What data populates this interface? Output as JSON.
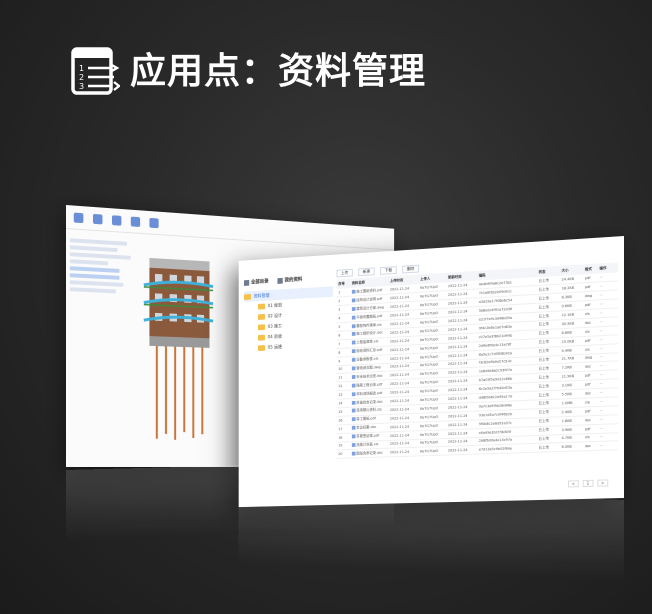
{
  "page": {
    "title": "应用点：资料管理"
  },
  "colors": {
    "background": "#2a2a2a",
    "folder": "#f5c14b",
    "accent": "#2f6bd8"
  },
  "back_window": {
    "icons": [
      "folder-icon",
      "upload-icon",
      "download-icon",
      "share-icon",
      "settings-icon"
    ]
  },
  "front_window": {
    "tabs": [
      {
        "label": "全部目录",
        "icon": "catalog-icon"
      },
      {
        "label": "我的资料",
        "icon": "download-icon"
      }
    ],
    "tree": {
      "root": "资料管理",
      "items": [
        "01 规划",
        "02 设计",
        "03 施工",
        "04 验收",
        "05 运维"
      ]
    },
    "actions": [
      "上传",
      "新建",
      "下载",
      "删除"
    ],
    "columns": [
      "序号",
      "资料名称",
      "上传时间",
      "上传人",
      "更新时间",
      "编码",
      "状态",
      "大小",
      "格式",
      "操作"
    ],
    "rows": [
      {
        "no": "1",
        "name": "施工图纸资料.pdf",
        "date": "2022-11-24",
        "user": "Ke7G7UpO",
        "time": "2022-11-24",
        "code": "4e4b9f9a8c2e73b1",
        "status": "已上传",
        "size": "24.4KB",
        "type": "pdf"
      },
      {
        "no": "2",
        "name": "结构设计说明.pdf",
        "date": "2022-11-24",
        "user": "Ke7G7UpO",
        "time": "2022-11-24",
        "code": "7c1a8f3b2e09d41c",
        "status": "已上传",
        "size": "18.2KB",
        "type": "pdf"
      },
      {
        "no": "3",
        "name": "建筑设计方案.dwg",
        "date": "2022-11-24",
        "user": "Ke7G7UpO",
        "time": "2022-11-24",
        "code": "a3d29e17f08b6c54",
        "status": "已上传",
        "size": "8.3KB",
        "type": "dwg"
      },
      {
        "no": "4",
        "name": "平面布置图纸.pdf",
        "date": "2022-11-24",
        "user": "Ke7G7UpO",
        "time": "2022-11-24",
        "code": "5b8e0c4f91a72d36",
        "status": "已上传",
        "size": "9.6KB",
        "type": "pdf"
      },
      {
        "no": "5",
        "name": "模型构件清单.xls",
        "date": "2022-11-24",
        "user": "Ke7G7UpO",
        "time": "2022-11-24",
        "code": "e21f7a9c3d48b05a",
        "status": "已上传",
        "size": "12.1KB",
        "type": "xls"
      },
      {
        "no": "6",
        "name": "施工组织设计.doc",
        "date": "2022-11-24",
        "user": "Ke7G7UpO",
        "time": "2022-11-24",
        "code": "9f4c2b6e1a07d83e",
        "status": "已上传",
        "size": "30.5KB",
        "type": "doc"
      },
      {
        "no": "7",
        "name": "工程量清单.xls",
        "date": "2022-11-24",
        "user": "Ke7G7UpO",
        "time": "2022-11-24",
        "code": "c07e5a3f8b21d94b",
        "status": "已上传",
        "size": "6.8KB",
        "type": "xls"
      },
      {
        "no": "8",
        "name": "验收资料汇总.pdf",
        "date": "2022-11-24",
        "user": "Ke7G7UpO",
        "time": "2022-11-24",
        "code": "2d9b6f0e4c13a78f",
        "status": "已上传",
        "size": "15.0KB",
        "type": "pdf"
      },
      {
        "no": "9",
        "name": "设备参数表.xls",
        "date": "2022-11-24",
        "user": "Ke7G7UpO",
        "time": "2022-11-24",
        "code": "8a5e1c7d3f06b92a",
        "status": "已上传",
        "size": "4.4KB",
        "type": "xls"
      },
      {
        "no": "10",
        "name": "管线综合图.dwg",
        "date": "2022-11-24",
        "user": "Ke7G7UpO",
        "time": "2022-11-24",
        "code": "f3c82a9b0e57d14c",
        "status": "已上传",
        "size": "21.7KB",
        "type": "dwg"
      },
      {
        "no": "11",
        "name": "安全技术交底.doc",
        "date": "2022-11-24",
        "user": "Ke7G7UpO",
        "time": "2022-11-24",
        "code": "1e6d4b8a2c93f07e",
        "status": "已上传",
        "size": "7.2KB",
        "type": "doc"
      },
      {
        "no": "12",
        "name": "隐蔽工程记录.pdf",
        "date": "2022-11-24",
        "user": "Ke7G7UpO",
        "time": "2022-11-24",
        "code": "b7a03f5e9d12c68b",
        "status": "已上传",
        "size": "11.9KB",
        "type": "pdf"
      },
      {
        "no": "13",
        "name": "材料进场报验.pdf",
        "date": "2022-11-24",
        "user": "Ke7G7UpO",
        "time": "2022-11-24",
        "code": "6c2e9a1f7b40d53a",
        "status": "已上传",
        "size": "3.1KB",
        "type": "pdf"
      },
      {
        "no": "14",
        "name": "质量检查记录.doc",
        "date": "2022-11-24",
        "user": "Ke7G7UpO",
        "time": "2022-11-24",
        "code": "d48f0b6c2a95e17d",
        "status": "已上传",
        "size": "5.5KB",
        "type": "doc"
      },
      {
        "no": "15",
        "name": "现场照片资料.zip",
        "date": "2022-11-24",
        "user": "Ke7G7UpO",
        "time": "2022-11-24",
        "code": "0a7c3e9f5b28d46e",
        "status": "已上传",
        "size": "1.0MB",
        "type": "zip"
      },
      {
        "no": "16",
        "name": "竣工图纸.pdf",
        "date": "2022-11-24",
        "user": "Ke7G7UpO",
        "time": "2022-11-24",
        "code": "93e1d5a7c0f46b2b",
        "status": "已上传",
        "size": "2.4KB",
        "type": "pdf"
      },
      {
        "no": "17",
        "name": "会议纪要.doc",
        "date": "2022-11-24",
        "user": "Ke7G7UpO",
        "time": "2022-11-24",
        "code": "5f0b8c2e6d91a37c",
        "status": "已上传",
        "size": "1.8KB",
        "type": "doc"
      },
      {
        "no": "18",
        "name": "变更签证单.pdf",
        "date": "2022-11-24",
        "user": "Ke7G7UpO",
        "time": "2022-11-24",
        "code": "c6a49e3b1f78d05f",
        "status": "已上传",
        "size": "3.9KB",
        "type": "pdf"
      },
      {
        "no": "19",
        "name": "进度计划表.xls",
        "date": "2022-11-24",
        "user": "Ke7G7UpO",
        "time": "2022-11-24",
        "code": "2b8f6d0a4e13c97a",
        "status": "已上传",
        "size": "4.7KB",
        "type": "xls"
      },
      {
        "no": "20",
        "name": "图纸会审记录.doc",
        "date": "2022-11-24",
        "user": "Ke7G7UpO",
        "time": "2022-11-24",
        "code": "e7d13a5c9b02f64e",
        "status": "已上传",
        "size": "6.0KB",
        "type": "doc"
      }
    ],
    "pager": [
      "<",
      "1",
      ">"
    ]
  }
}
